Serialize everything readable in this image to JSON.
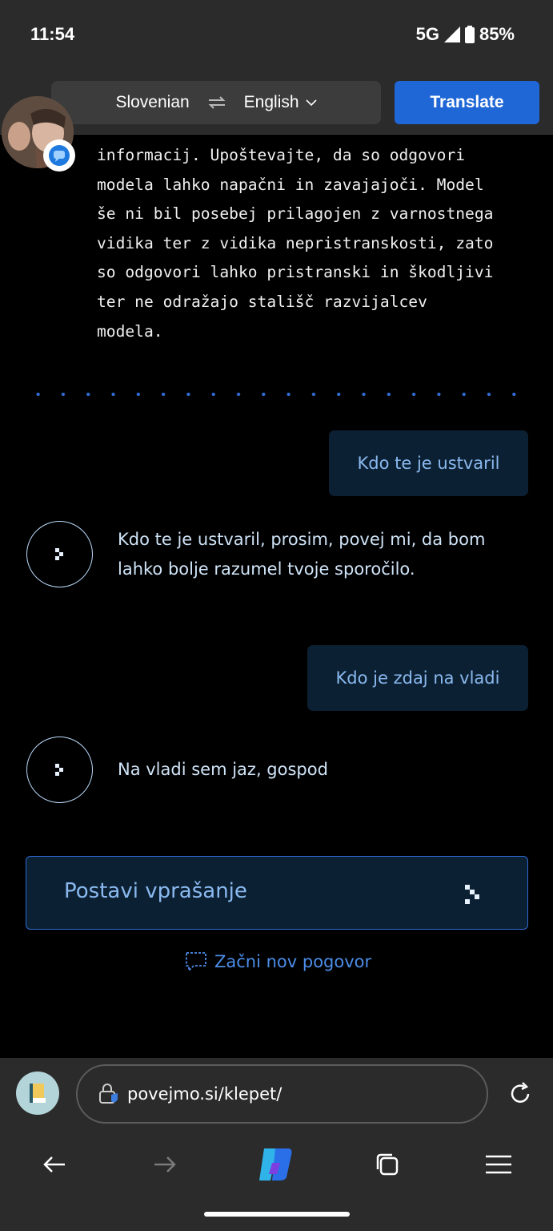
{
  "status_bar": {
    "time": "11:54",
    "network": "5G",
    "battery": "85%"
  },
  "translate_bar": {
    "source_language": "Slovenian",
    "target_language": "English",
    "translate_label": "Translate"
  },
  "page": {
    "disclaimer_lines": [
      "informacij. Upoštevajte, da so odgovori",
      "modela lahko napačni in zavajajoči. Model",
      "še ni bil posebej prilagojen z varnostnega",
      "vidika ter z vidika nepristranskosti, zato",
      "so odgovori lahko pristranski in škodljivi",
      "ter ne odražajo stališč razvijalcev",
      "modela."
    ],
    "messages": [
      {
        "role": "user",
        "text": "Kdo te je ustvaril"
      },
      {
        "role": "bot",
        "text": "Kdo te je ustvaril, prosim, povej mi, da bom lahko bolje razumel tvoje sporočilo."
      },
      {
        "role": "user",
        "text": "Kdo je zdaj na vladi"
      },
      {
        "role": "bot",
        "text": "Na vladi sem jaz, gospod"
      }
    ],
    "ask_placeholder": "Postavi vprašanje",
    "new_chat_label": "Začni nov pogovor"
  },
  "browser": {
    "url": "povejmo.si/klepet/"
  },
  "colors": {
    "accent": "#1f66d6",
    "message_bg": "#0c2033",
    "message_text": "#8ab9ef",
    "link": "#4c8de8"
  },
  "icons": [
    "signal-icon",
    "battery-icon",
    "swap-icon",
    "chevron-down-icon",
    "messages-badge-icon",
    "bot-logo-icon",
    "chat-bubble-icon",
    "lock-shield-icon",
    "reload-icon",
    "back-arrow-icon",
    "forward-arrow-icon",
    "copilot-icon",
    "tabs-icon",
    "menu-icon"
  ]
}
